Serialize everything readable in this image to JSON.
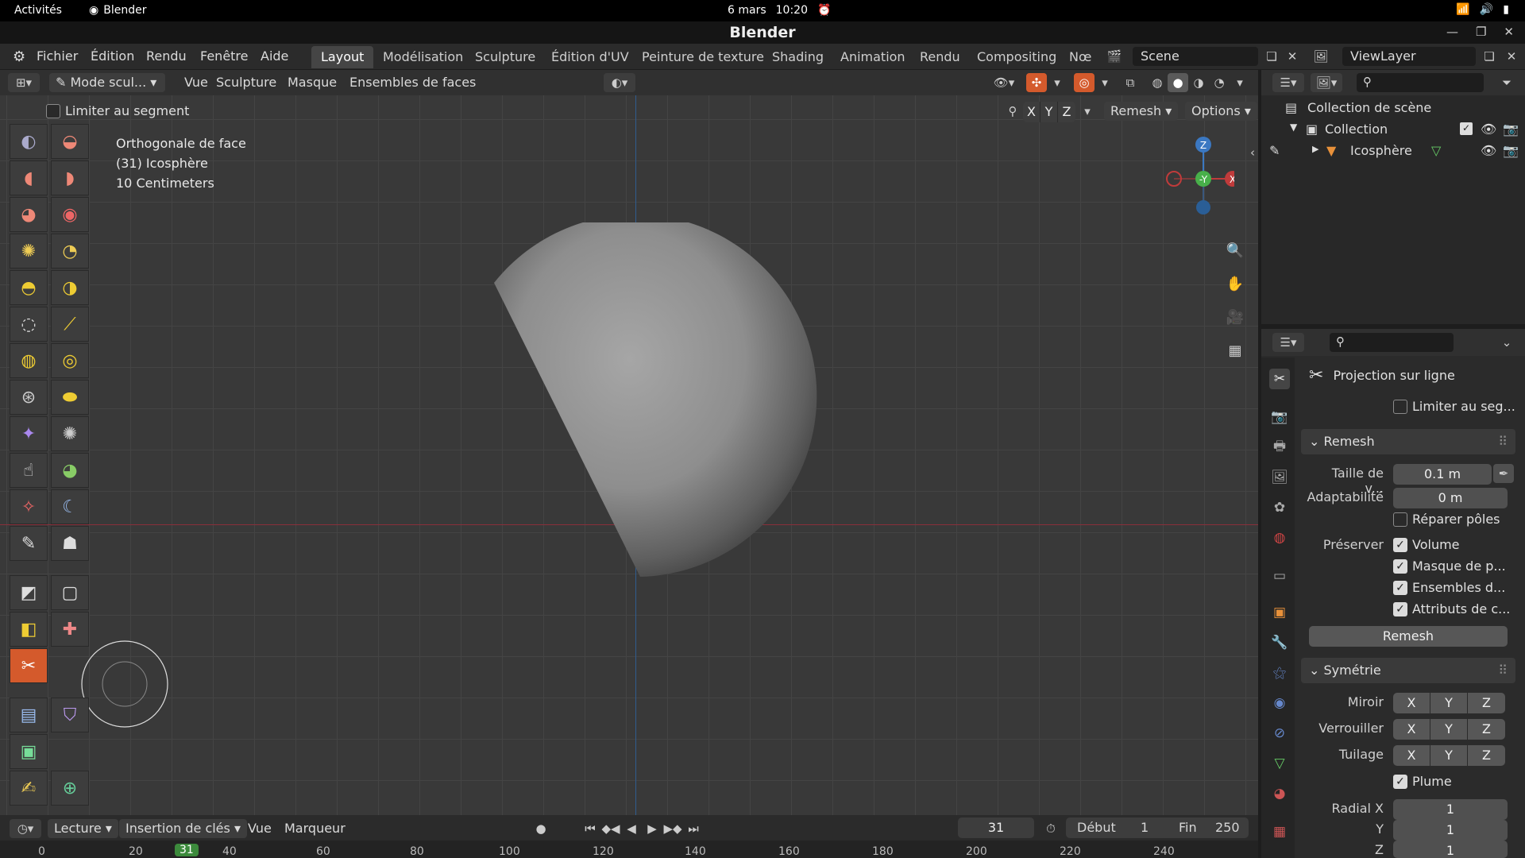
{
  "system_bar": {
    "activities": "Activités",
    "app_name": "Blender",
    "date": "6 mars",
    "time": "10:20"
  },
  "window": {
    "title": "Blender"
  },
  "menu": [
    "Fichier",
    "Édition",
    "Rendu",
    "Fenêtre",
    "Aide"
  ],
  "workspaces": [
    "Layout",
    "Modélisation",
    "Sculpture",
    "Édition d'UV",
    "Peinture de texture",
    "Shading",
    "Animation",
    "Rendu",
    "Compositing",
    "Nœ"
  ],
  "scene_field": "Scene",
  "viewlayer_field": "ViewLayer",
  "viewport_header": {
    "mode": "Mode scul...",
    "menus": [
      "Vue",
      "Sculpture",
      "Masque",
      "Ensembles de faces"
    ],
    "axes": [
      "X",
      "Y",
      "Z"
    ],
    "remesh": "Remesh",
    "options": "Options"
  },
  "tool_options": {
    "limit_segment": "Limiter au segment"
  },
  "overlay_text": {
    "view": "Orthogonale de face",
    "object": "(31) Icosphère",
    "scale": "10 Centimeters"
  },
  "gizmo": {
    "z": "Z",
    "y": "-Y",
    "x": "X"
  },
  "outliner": {
    "scene_collection": "Collection de scène",
    "collection": "Collection",
    "object": "Icosphère"
  },
  "properties": {
    "tool_name": "Projection sur ligne",
    "limit_segment": "Limiter au seg...",
    "remesh": {
      "title": "Remesh",
      "voxel_size_label": "Taille de v...",
      "voxel_size_value": "0.1 m",
      "adaptivity_label": "Adaptabilité",
      "adaptivity_value": "0 m",
      "fix_poles": "Réparer pôles",
      "preserve_label": "Préserver",
      "preserve_volume": "Volume",
      "preserve_mask": "Masque de p...",
      "preserve_facesets": "Ensembles d...",
      "preserve_attributes": "Attributs de c...",
      "button": "Remesh"
    },
    "symmetry": {
      "title": "Symétrie",
      "mirror_label": "Miroir",
      "lock_label": "Verrouiller",
      "tiling_label": "Tuilage",
      "axes": [
        "X",
        "Y",
        "Z"
      ],
      "feather": "Plume",
      "radial_x_label": "Radial X",
      "radial_y_label": "Y",
      "radial_z_label": "Z",
      "radial_x": "1",
      "radial_y": "1",
      "radial_z": "1"
    }
  },
  "timeline": {
    "playback": "Lecture",
    "keying": "Insertion de clés",
    "view": "Vue",
    "marker": "Marqueur",
    "current_frame": "31",
    "start_label": "Début",
    "start": "1",
    "end_label": "Fin",
    "end": "250",
    "ruler": [
      "0",
      "20",
      "31",
      "40",
      "60",
      "80",
      "100",
      "120",
      "140",
      "160",
      "180",
      "200",
      "220",
      "240"
    ]
  }
}
